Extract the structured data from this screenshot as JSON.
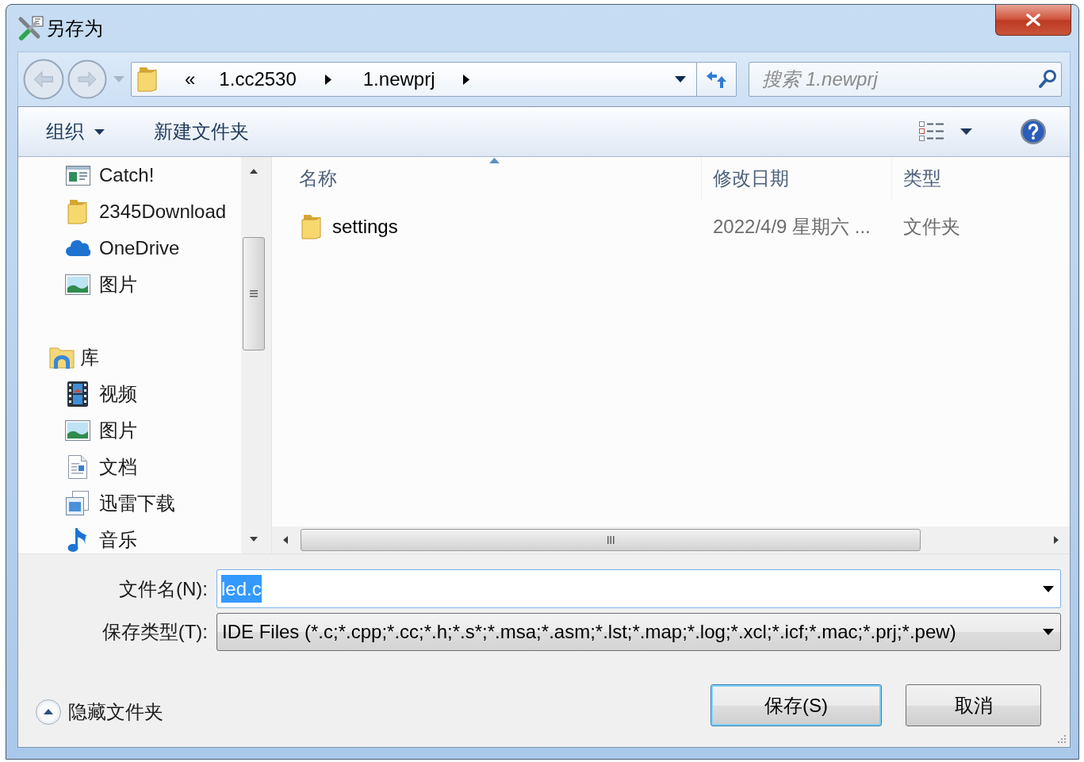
{
  "window": {
    "title": "另存为"
  },
  "navigation": {
    "back": {
      "disabled": true
    },
    "forward": {
      "disabled": true
    }
  },
  "address_bar": {
    "overflow": "«",
    "crumbs": [
      "1.cc2530",
      "1.newprj"
    ]
  },
  "search": {
    "placeholder": "搜索 1.newprj"
  },
  "toolbar": {
    "organize": "组织",
    "new_folder": "新建文件夹"
  },
  "nav_pane": {
    "tree": [
      {
        "children": [
          {
            "label": "Catch!",
            "kind": "app",
            "selected": false
          },
          {
            "label": "2345Download",
            "kind": "folder",
            "selected": false
          },
          {
            "label": "OneDrive",
            "kind": "cloud",
            "selected": false
          },
          {
            "label": "图片",
            "kind": "pictures",
            "selected": false
          }
        ]
      },
      {
        "label": "库",
        "kind": "library",
        "selected": false,
        "children": [
          {
            "label": "视频",
            "kind": "video",
            "selected": false
          },
          {
            "label": "图片",
            "kind": "pictures",
            "selected": false
          },
          {
            "label": "文档",
            "kind": "document",
            "selected": false
          },
          {
            "label": "迅雷下载",
            "kind": "download",
            "selected": false
          },
          {
            "label": "音乐",
            "kind": "music",
            "selected": false
          }
        ]
      }
    ]
  },
  "file_list": {
    "columns": [
      {
        "label": "名称",
        "sorted": true
      },
      {
        "label": "修改日期",
        "sorted": false
      },
      {
        "label": "类型",
        "sorted": false
      }
    ],
    "rows": [
      {
        "kind": "folder",
        "name": "settings",
        "modified": "2022/4/9 星期六 ...",
        "type": "文件夹",
        "selected": false
      }
    ]
  },
  "form": {
    "file_name": {
      "label": "文件名(N):",
      "value": "led.c",
      "text_selected": true
    },
    "save_type": {
      "label": "保存类型(T):",
      "value": "IDE Files (*.c;*.cpp;*.cc;*.h;*.s*;*.msa;*.asm;*.lst;*.map;*.log;*.xcl;*.icf;*.mac;*.prj;*.pew)"
    }
  },
  "hide_folders": {
    "label": "隐藏文件夹"
  },
  "buttons": [
    {
      "label": "保存(S)",
      "default": true
    },
    {
      "label": "取消",
      "default": false
    }
  ]
}
